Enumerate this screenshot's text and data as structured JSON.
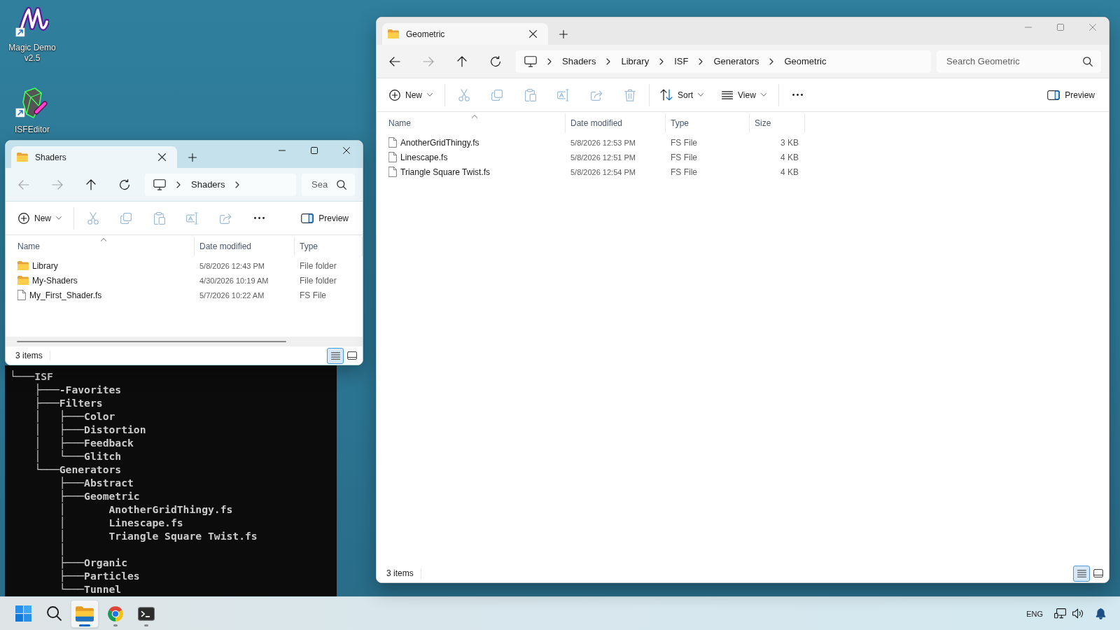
{
  "desktop_icons": [
    {
      "kind": "magic_demo",
      "label": "Magic Demo v2.5"
    },
    {
      "kind": "isf_editor",
      "label": "ISFEditor"
    }
  ],
  "explorer_windows": [
    {
      "active": true,
      "tab": {
        "title": "Shaders"
      },
      "nav_buttons": [
        {
          "kind": "back",
          "disabled": true
        },
        {
          "kind": "forward",
          "disabled": true
        },
        {
          "kind": "up",
          "disabled": false
        },
        {
          "kind": "refresh",
          "disabled": false
        }
      ],
      "breadcrumbs": [
        "Shaders"
      ],
      "trailing_chevron": true,
      "search": {
        "placeholder": "Sea"
      },
      "commands": [
        {
          "kind": "new",
          "label": "New",
          "disabled": false
        },
        {
          "kind": "separator"
        },
        {
          "kind": "cut",
          "disabled": true
        },
        {
          "kind": "copy",
          "disabled": true
        },
        {
          "kind": "paste",
          "disabled": true
        },
        {
          "kind": "rename",
          "disabled": true
        },
        {
          "kind": "share",
          "disabled": true
        },
        {
          "kind": "more",
          "disabled": false
        }
      ],
      "preview": {
        "label": "Preview"
      },
      "columns": [
        {
          "kind": "name",
          "label": "Name",
          "sorted": true
        },
        {
          "kind": "date",
          "label": "Date modified",
          "sorted": false
        },
        {
          "kind": "type",
          "label": "Type",
          "sorted": false
        }
      ],
      "rows": [
        {
          "kind": "folder",
          "cells": [
            "Library",
            "5/8/2026 12:43 PM",
            "File folder"
          ]
        },
        {
          "kind": "folder",
          "cells": [
            "My-Shaders",
            "4/30/2026 10:19 AM",
            "File folder"
          ]
        },
        {
          "kind": "file",
          "cells": [
            "My_First_Shader.fs",
            "5/7/2026 10:22 AM",
            "FS File"
          ]
        }
      ],
      "horizontal_scrollbar": true,
      "status": "3 items",
      "view_buttons": [
        {
          "kind": "details",
          "selected": true
        },
        {
          "kind": "tiles",
          "selected": false
        }
      ]
    },
    {
      "active": false,
      "tab": {
        "title": "Geometric"
      },
      "nav_buttons": [
        {
          "kind": "back",
          "disabled": false
        },
        {
          "kind": "forward",
          "disabled": true
        },
        {
          "kind": "up",
          "disabled": false
        },
        {
          "kind": "refresh",
          "disabled": false
        }
      ],
      "breadcrumbs": [
        "Shaders",
        "Library",
        "ISF",
        "Generators",
        "Geometric"
      ],
      "trailing_chevron": false,
      "search": {
        "placeholder": "Search Geometric"
      },
      "commands": [
        {
          "kind": "new",
          "label": "New",
          "disabled": false
        },
        {
          "kind": "separator"
        },
        {
          "kind": "cut",
          "disabled": true
        },
        {
          "kind": "copy",
          "disabled": true
        },
        {
          "kind": "paste",
          "disabled": true
        },
        {
          "kind": "rename",
          "disabled": true
        },
        {
          "kind": "share",
          "disabled": true
        },
        {
          "kind": "delete",
          "disabled": true
        },
        {
          "kind": "separator"
        },
        {
          "kind": "sort",
          "label": "Sort",
          "disabled": false
        },
        {
          "kind": "view",
          "label": "View",
          "disabled": false
        },
        {
          "kind": "separator"
        },
        {
          "kind": "more",
          "disabled": false
        }
      ],
      "preview": {
        "label": "Preview"
      },
      "columns": [
        {
          "kind": "name",
          "label": "Name",
          "sorted": true
        },
        {
          "kind": "date",
          "label": "Date modified",
          "sorted": false
        },
        {
          "kind": "type",
          "label": "Type",
          "sorted": false
        },
        {
          "kind": "size",
          "label": "Size",
          "sorted": false
        }
      ],
      "rows": [
        {
          "kind": "file",
          "cells": [
            "AnotherGridThingy.fs",
            "5/8/2026 12:53 PM",
            "FS File",
            "3 KB"
          ]
        },
        {
          "kind": "file",
          "cells": [
            "Linescape.fs",
            "5/8/2026 12:51 PM",
            "FS File",
            "4 KB"
          ]
        },
        {
          "kind": "file",
          "cells": [
            "Triangle Square Twist.fs",
            "5/8/2026 12:54 PM",
            "FS File",
            "4 KB"
          ]
        }
      ],
      "horizontal_scrollbar": false,
      "status": "3 items",
      "view_buttons": [
        {
          "kind": "details",
          "selected": true
        },
        {
          "kind": "tiles",
          "selected": false
        }
      ]
    }
  ],
  "terminal": {
    "lines": [
      "└───ISF",
      "    ├───-Favorites",
      "    ├───Filters",
      "    │   ├───Color",
      "    │   ├───Distortion",
      "    │   ├───Feedback",
      "    │   └───Glitch",
      "    └───Generators",
      "        ├───Abstract",
      "        ├───Geometric",
      "        │       AnotherGridThingy.fs",
      "        │       Linescape.fs",
      "        │       Triangle Square Twist.fs",
      "        │",
      "        ├───Organic",
      "        ├───Particles",
      "        └───Tunnel"
    ]
  },
  "taskbar": {
    "apps": [
      {
        "kind": "file_explorer",
        "running": true,
        "active": true
      },
      {
        "kind": "browser",
        "running": true,
        "active": false
      },
      {
        "kind": "terminal",
        "running": true,
        "active": false
      }
    ],
    "language": "ENG"
  }
}
